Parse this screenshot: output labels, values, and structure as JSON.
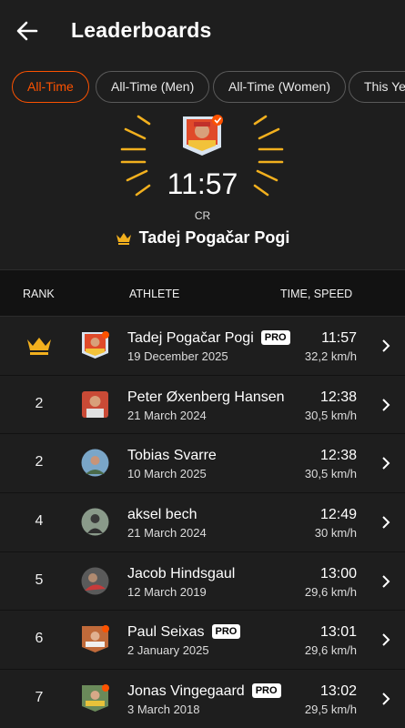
{
  "header": {
    "title": "Leaderboards",
    "back_icon": "arrow-left-icon"
  },
  "filters": [
    {
      "label": "All-Time",
      "active": true
    },
    {
      "label": "All-Time (Men)",
      "active": false
    },
    {
      "label": "All-Time (Women)",
      "active": false
    },
    {
      "label": "This Yea",
      "active": false
    }
  ],
  "hero": {
    "time": "11:57",
    "label": "CR",
    "name": "Tadej Pogačar Pogi",
    "crown_icon": "crown-icon"
  },
  "table": {
    "headers": {
      "rank": "RANK",
      "athlete": "ATHLETE",
      "time": "TIME, SPEED"
    },
    "rows": [
      {
        "rank": "",
        "crown": true,
        "name": "Tadej Pogačar Pogi",
        "pro": "PRO",
        "date": "19 December 2025",
        "time": "11:57",
        "speed": "32,2 km/h"
      },
      {
        "rank": "2",
        "crown": false,
        "name": "Peter Øxenberg Hansen",
        "pro": "",
        "date": "21 March 2024",
        "time": "12:38",
        "speed": "30,5 km/h"
      },
      {
        "rank": "2",
        "crown": false,
        "name": "Tobias Svarre",
        "pro": "",
        "date": "10 March 2025",
        "time": "12:38",
        "speed": "30,5 km/h"
      },
      {
        "rank": "4",
        "crown": false,
        "name": "aksel bech",
        "pro": "",
        "date": "21 March 2024",
        "time": "12:49",
        "speed": "30 km/h"
      },
      {
        "rank": "5",
        "crown": false,
        "name": "Jacob Hindsgaul",
        "pro": "",
        "date": "12 March 2019",
        "time": "13:00",
        "speed": "29,6 km/h"
      },
      {
        "rank": "6",
        "crown": false,
        "name": "Paul  Seixas",
        "pro": "PRO",
        "date": "2 January 2025",
        "time": "13:01",
        "speed": "29,6 km/h"
      },
      {
        "rank": "7",
        "crown": false,
        "name": "Jonas  Vingegaard",
        "pro": "PRO",
        "date": "3 March 2018",
        "time": "13:02",
        "speed": "29,5 km/h"
      }
    ]
  },
  "colors": {
    "accent": "#fc5200",
    "gold": "#f2b01e",
    "background": "#121212",
    "surface": "#1e1e1e"
  }
}
